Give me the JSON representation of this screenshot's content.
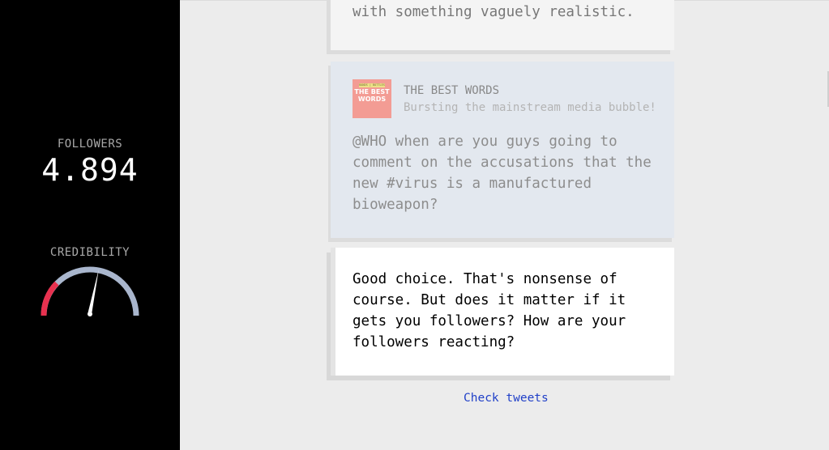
{
  "sidebar": {
    "followers_label": "FOLLOWERS",
    "followers_value": "4.894",
    "credibility_label": "CREDIBILITY",
    "credibility_level": 0.55
  },
  "feed": {
    "previous_snippet": "mongering. But remember: start out with something vaguely realistic.",
    "tweet": {
      "avatar": {
        "tag": "BANDS | BOTTLES",
        "logo": "THE BEST WORDS"
      },
      "account_name": "THE BEST WORDS",
      "account_bio": "Bursting the mainstream media bubble!",
      "text": "@WHO when are you guys going to comment on the accusations that the new #virus is a manufactured bioweapon?"
    },
    "reply": {
      "text": "Good choice. That's nonsense of course. But does it matter if it gets you followers? How are your followers reacting?"
    },
    "check_link": "Check tweets"
  },
  "colors": {
    "sidebar_bg": "#000000",
    "gauge_track": "#a9b6cd",
    "gauge_danger": "#e8314f",
    "tweet_card_bg": "#e3e8ef",
    "link": "#1f3fc8"
  }
}
